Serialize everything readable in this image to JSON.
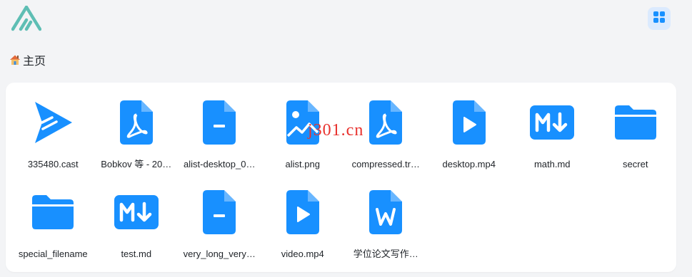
{
  "app": {
    "logo_icon": "alist-logo-icon",
    "layout_toggle_icon": "grid-view-icon"
  },
  "breadcrumb": {
    "icon": "home-icon",
    "label": "主页"
  },
  "colors": {
    "accent": "#1890ff",
    "logo": "#5ebeb4",
    "layout_button_bg": "#dbeafe",
    "watermark": "#e8322e"
  },
  "files": [
    {
      "name": "335480.cast",
      "icon": "video-play-triangle-icon"
    },
    {
      "name": "Bobkov 等 - 20…",
      "icon": "pdf-file-icon"
    },
    {
      "name": "alist-desktop_0…",
      "icon": "generic-file-icon"
    },
    {
      "name": "alist.png",
      "icon": "image-file-icon"
    },
    {
      "name": "compressed.tr…",
      "icon": "pdf-file-icon"
    },
    {
      "name": "desktop.mp4",
      "icon": "video-file-icon"
    },
    {
      "name": "math.md",
      "icon": "markdown-file-icon"
    },
    {
      "name": "secret",
      "icon": "folder-icon"
    },
    {
      "name": "special_filename",
      "icon": "folder-icon"
    },
    {
      "name": "test.md",
      "icon": "markdown-file-icon"
    },
    {
      "name": "very_long_very…",
      "icon": "generic-file-icon"
    },
    {
      "name": "video.mp4",
      "icon": "video-file-icon"
    },
    {
      "name": "学位论文写作…",
      "icon": "word-file-icon"
    }
  ],
  "watermark": "j301.cn"
}
